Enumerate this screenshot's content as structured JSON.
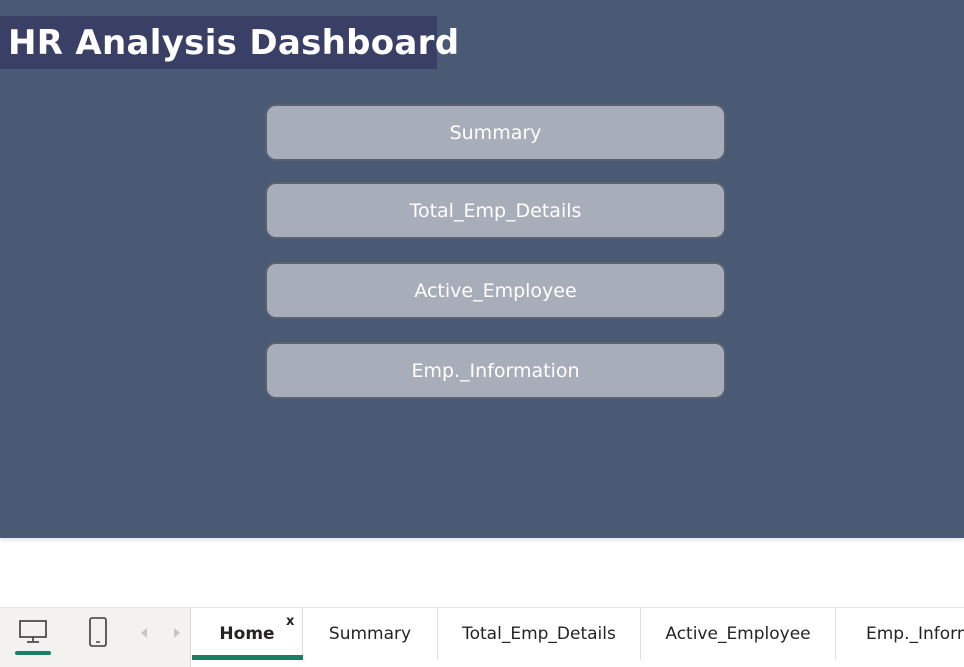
{
  "title": "HR Analysis Dashboard",
  "buttons": [
    {
      "label": "Summary"
    },
    {
      "label": "Total_Emp_Details"
    },
    {
      "label": "Active_Employee"
    },
    {
      "label": "Emp._Information"
    }
  ],
  "view_toggle": {
    "desktop_icon": "desktop-monitor-icon",
    "mobile_icon": "mobile-phone-icon",
    "selected": "desktop"
  },
  "page_nav": {
    "prev_icon": "chevron-left-icon",
    "next_icon": "chevron-right-icon"
  },
  "tabs": [
    {
      "label": "Home",
      "active": true
    },
    {
      "label": "Summary"
    },
    {
      "label": "Total_Emp_Details"
    },
    {
      "label": "Active_Employee"
    },
    {
      "label": "Emp._Inform"
    }
  ],
  "close_label": "x",
  "colors": {
    "canvas_background": "#4a5a75",
    "title_background": "#3a3f66",
    "button_fill": "#a7adb9",
    "button_border": "#5a6170",
    "accent": "#1a7f64"
  }
}
